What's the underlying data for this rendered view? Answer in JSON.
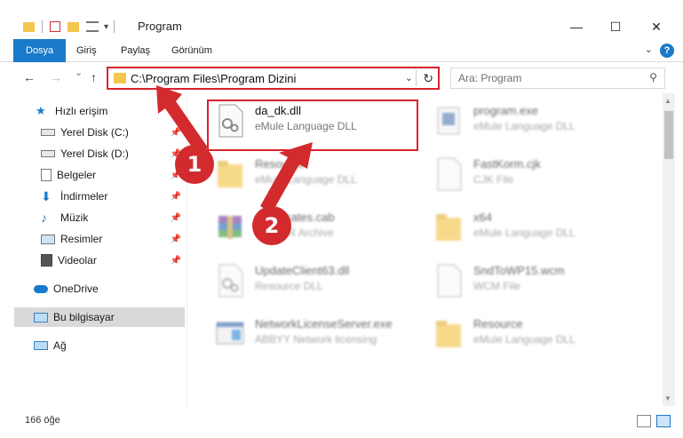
{
  "window": {
    "title": "Program",
    "minimize": "—",
    "maximize": "☐",
    "close": "✕"
  },
  "ribbon": {
    "tabs": [
      "Dosya",
      "Giriş",
      "Paylaş",
      "Görünüm"
    ],
    "help": "?"
  },
  "nav": {
    "back": "←",
    "forward": "→",
    "recent": "⌄",
    "up": "↑",
    "address": "C:\\Program Files\\Program Dizini",
    "search_placeholder": "Ara: Program"
  },
  "sidebar": {
    "items": [
      {
        "label": "Hızlı erişim",
        "icon": "star-icon",
        "pinned": false
      },
      {
        "label": "Yerel Disk (C:)",
        "icon": "drive-icon",
        "pinned": true
      },
      {
        "label": "Yerel Disk (D:)",
        "icon": "drive-icon",
        "pinned": true
      },
      {
        "label": "Belgeler",
        "icon": "documents-icon",
        "pinned": true
      },
      {
        "label": "İndirmeler",
        "icon": "download-icon",
        "pinned": true
      },
      {
        "label": "Müzik",
        "icon": "music-icon",
        "pinned": true
      },
      {
        "label": "Resimler",
        "icon": "pictures-icon",
        "pinned": true
      },
      {
        "label": "Videolar",
        "icon": "videos-icon",
        "pinned": true
      },
      {
        "label": "OneDrive",
        "icon": "cloud-icon",
        "pinned": false
      },
      {
        "label": "Bu bilgisayar",
        "icon": "computer-icon",
        "pinned": false
      },
      {
        "label": "Ağ",
        "icon": "network-icon",
        "pinned": false
      }
    ]
  },
  "files": [
    {
      "name": "da_dk.dll",
      "type": "eMule Language DLL",
      "icon": "dll-gear-icon",
      "faded": false
    },
    {
      "name": "program.exe",
      "type": "eMule Language DLL",
      "icon": "exe-icon",
      "faded": true
    },
    {
      "name": "Resource",
      "type": "eMule Language DLL",
      "icon": "folder-icon",
      "faded": true
    },
    {
      "name": "FastKorm.cjk",
      "type": "CJK File",
      "icon": "blank-file-icon",
      "faded": true
    },
    {
      "name": "Certificates.cab",
      "type": "WinRAR Archive",
      "icon": "archive-icon",
      "faded": true
    },
    {
      "name": "x64",
      "type": "eMule Language DLL",
      "icon": "folder-icon",
      "faded": true
    },
    {
      "name": "UpdateClient63.dll",
      "type": "Resource DLL",
      "icon": "dll-gear-icon",
      "faded": true
    },
    {
      "name": "SndToWP15.wcm",
      "type": "WCM File",
      "icon": "blank-file-icon",
      "faded": true
    },
    {
      "name": "NetworkLicenseServer.exe",
      "type": "ABBYY Network licensing",
      "icon": "exe-icon",
      "faded": true
    },
    {
      "name": "Resource",
      "type": "eMule Language DLL",
      "icon": "folder-icon",
      "faded": true
    }
  ],
  "markers": [
    "1",
    "2"
  ],
  "status": {
    "count": "166 öğe"
  },
  "colors": {
    "accent": "#1979ca",
    "annotation": "#d32a2e",
    "folder": "#f3c64d"
  }
}
